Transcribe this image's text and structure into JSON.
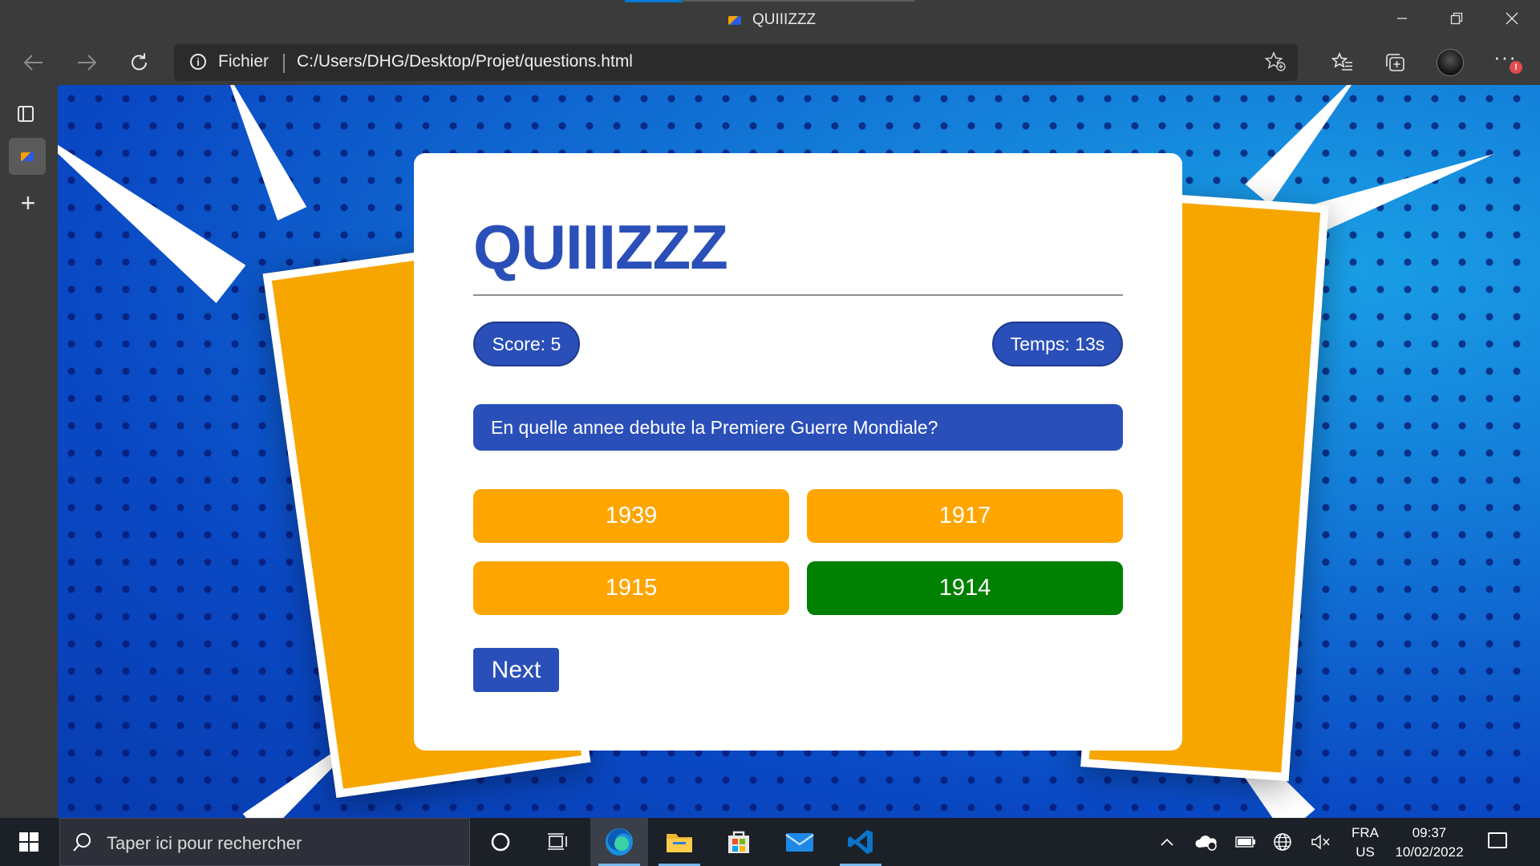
{
  "window": {
    "title": "QUIIIZZZ",
    "minimize_icon": "minimize-icon",
    "restore_icon": "restore-icon",
    "close_icon": "close-icon"
  },
  "addressbar": {
    "security_label": "Fichier",
    "url": "C:/Users/DHG/Desktop/Projet/questions.html"
  },
  "quiz": {
    "title": "QUIIIZZZ",
    "score_label": "Score: 5",
    "time_label": "Temps: 13s",
    "question": "En quelle annee debute la Premiere Guerre Mondiale?",
    "answers": [
      {
        "label": "1939",
        "state": "wrong",
        "color": "#ffa500"
      },
      {
        "label": "1917",
        "state": "wrong",
        "color": "#ffa500"
      },
      {
        "label": "1915",
        "state": "wrong",
        "color": "#ffa500"
      },
      {
        "label": "1914",
        "state": "correct",
        "color": "#008000"
      }
    ],
    "next_label": "Next",
    "accent_color": "#2a4fb9"
  },
  "taskbar": {
    "search_placeholder": "Taper ici pour rechercher",
    "apps": [
      "cortana-circle-icon",
      "task-view-icon",
      "edge-icon",
      "file-explorer-icon",
      "microsoft-store-icon",
      "mail-icon",
      "vscode-icon"
    ],
    "lang_top": "FRA",
    "lang_bottom": "US",
    "time": "09:37",
    "date": "10/02/2022"
  }
}
